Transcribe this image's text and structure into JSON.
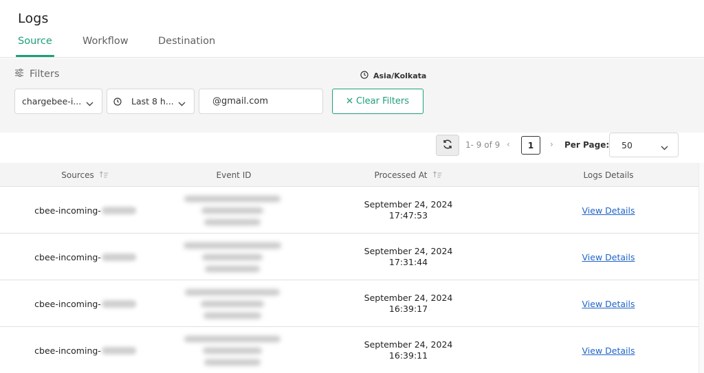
{
  "page": {
    "title": "Logs"
  },
  "tabs": [
    {
      "label": "Source",
      "active": true
    },
    {
      "label": "Workflow",
      "active": false
    },
    {
      "label": "Destination",
      "active": false
    }
  ],
  "filters": {
    "label": "Filters",
    "timezone": "Asia/Kolkata",
    "source_value": "chargebee-i...",
    "time_value": "Last 8 h...",
    "email_value": "@gmail.com",
    "clear_label": "Clear Filters"
  },
  "pagination": {
    "range_text": "1- 9 of 9",
    "current_page": "1",
    "prev_symbol": "‹",
    "next_symbol": "›",
    "per_page_label": "Per Page:",
    "per_page_value": "50"
  },
  "table": {
    "headers": {
      "sources": "Sources",
      "event_id": "Event ID",
      "processed_at": "Processed At",
      "logs_details": "Logs Details"
    },
    "rows": [
      {
        "source": "cbee-incoming-",
        "date": "September 24, 2024",
        "time": "17:47:53",
        "link": "View Details"
      },
      {
        "source": "cbee-incoming-",
        "date": "September 24, 2024",
        "time": "17:31:44",
        "link": "View Details"
      },
      {
        "source": "cbee-incoming-",
        "date": "September 24, 2024",
        "time": "16:39:17",
        "link": "View Details"
      },
      {
        "source": "cbee-incoming-",
        "date": "September 24, 2024",
        "time": "16:39:11",
        "link": "View Details"
      }
    ]
  },
  "colors": {
    "accent": "#1d9e7a",
    "link": "#1f63c9",
    "filter_bg": "#f5f5f5",
    "header_row_bg": "#f4f4f4"
  },
  "icons": {
    "filters": "sliders-icon",
    "timezone": "clock-icon",
    "time_select": "clock-icon",
    "dropdown": "chevron-down-icon",
    "clear": "close-icon",
    "refresh": "refresh-icon",
    "sort": "sort-icon"
  }
}
